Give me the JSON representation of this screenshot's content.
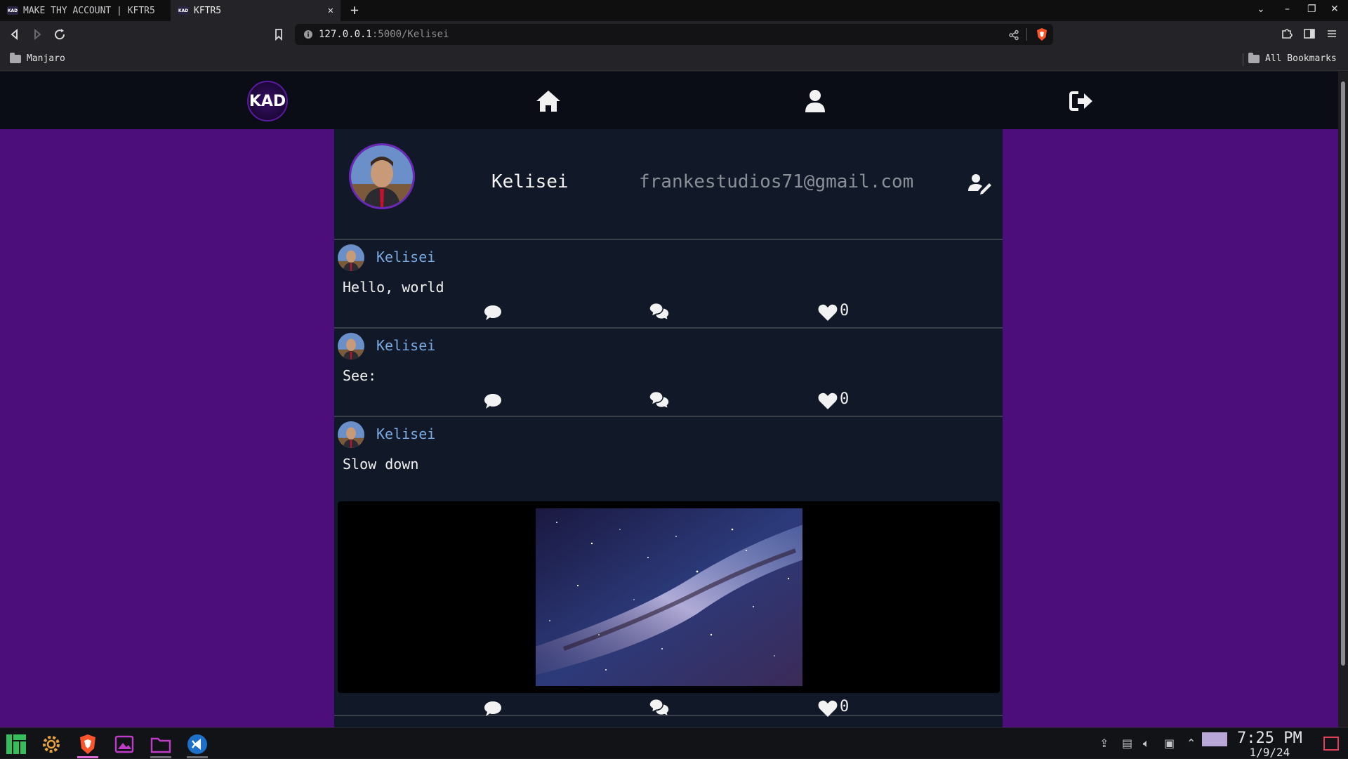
{
  "browser": {
    "tabs": [
      {
        "favicon": "KAD",
        "title": "MAKE THY ACCOUNT | KFTR5"
      },
      {
        "favicon": "KAD",
        "title": "KFTR5"
      }
    ],
    "url_host": "127.0.0.1",
    "url_path": ":5000/Kelisei",
    "bookmarks": {
      "left": "Manjaro",
      "right": "All Bookmarks"
    }
  },
  "site": {
    "logo": "KAD",
    "nav": [
      "home-icon",
      "user-icon",
      "logout-icon"
    ]
  },
  "profile": {
    "username": "Kelisei",
    "email": "frankestudios71@gmail.com"
  },
  "posts": [
    {
      "author": "Kelisei",
      "text": "Hello, world",
      "likes": "0"
    },
    {
      "author": "Kelisei",
      "text": "See:",
      "likes": "0"
    },
    {
      "author": "Kelisei",
      "text": "Slow down",
      "likes": "0",
      "image": "milky-way"
    }
  ],
  "taskbar": {
    "time": "7:25 PM",
    "date": "1/9/24"
  },
  "colors": {
    "page_bg": "#4b0e7a",
    "panel_bg": "#111827",
    "nav_bg": "#0b0d16",
    "username_link": "#78a9e0"
  }
}
